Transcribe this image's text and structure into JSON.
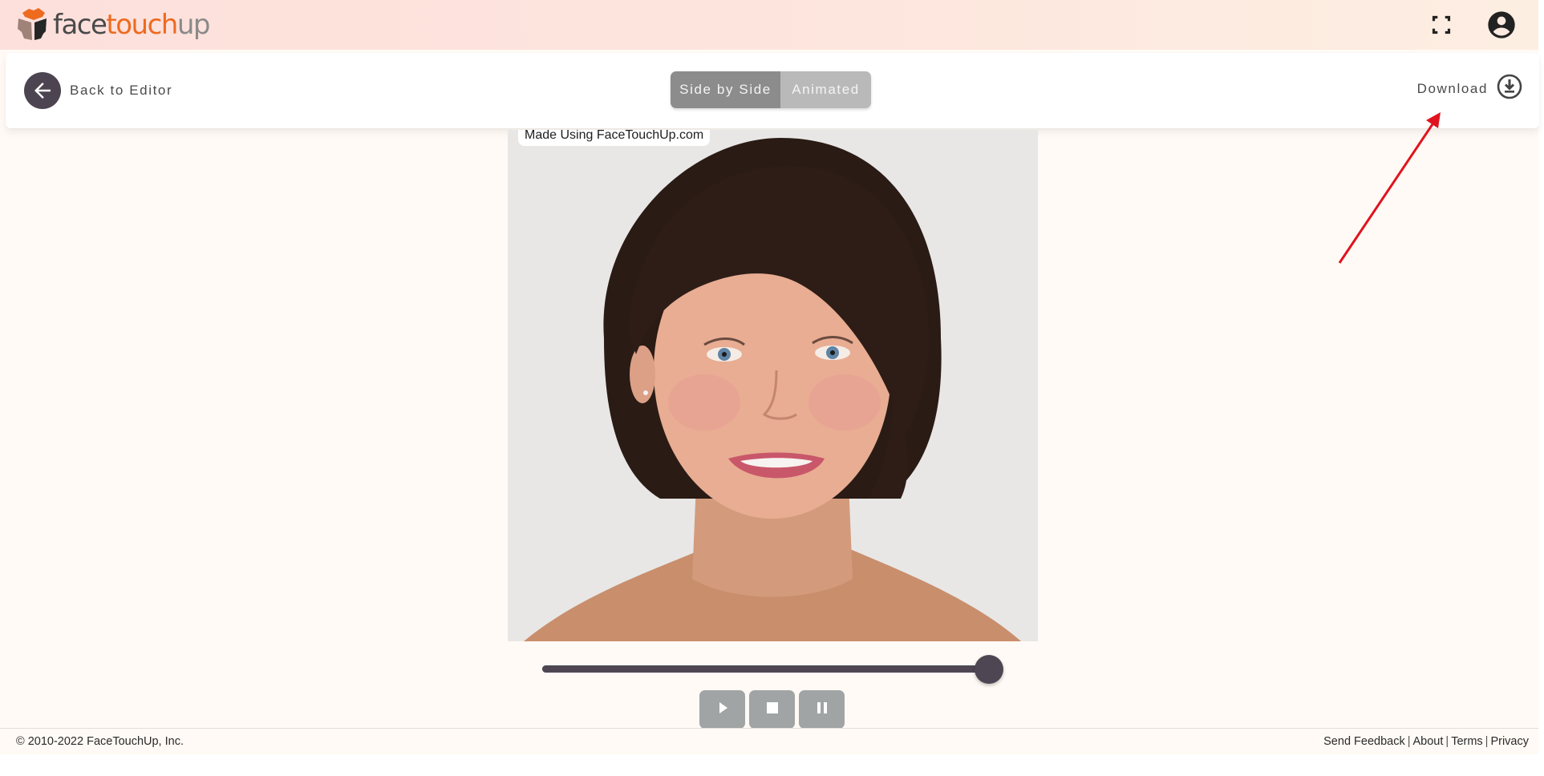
{
  "header": {
    "logo": {
      "part1": "face",
      "part2": "touch",
      "part3": "up",
      "icon": "facetouchup-logo-icon"
    },
    "icons": {
      "fullscreen": "fullscreen-icon",
      "account": "account-circle-icon"
    }
  },
  "toolbar": {
    "back_label": "Back to Editor",
    "back_icon": "arrow-left-icon",
    "view_modes": [
      {
        "label": "Side by Side",
        "selected": true
      },
      {
        "label": "Animated",
        "selected": false
      }
    ],
    "download_label": "Download",
    "download_icon": "download-circle-icon"
  },
  "photo": {
    "watermark": "Made Using FaceTouchUp.com",
    "description": "portrait of woman with short dark brown bob haircut"
  },
  "player": {
    "progress": 1.0,
    "controls": [
      {
        "name": "play",
        "icon": "play-icon"
      },
      {
        "name": "stop",
        "icon": "stop-icon"
      },
      {
        "name": "pause",
        "icon": "pause-icon"
      }
    ]
  },
  "footer": {
    "copyright": "© 2010-2022 FaceTouchUp, Inc.",
    "links": [
      "Send Feedback",
      "About",
      "Terms",
      "Privacy"
    ],
    "separator": "|"
  },
  "annotation": {
    "type": "arrow",
    "color": "#e0141e",
    "points_to": "download-button"
  },
  "colors": {
    "brand_orange": "#ee6a1f",
    "dark_accent": "#4f4653",
    "segment_selected": "#8c8c8c",
    "segment_unselected": "#b9b9b9",
    "control_button": "#a1a4a4"
  }
}
